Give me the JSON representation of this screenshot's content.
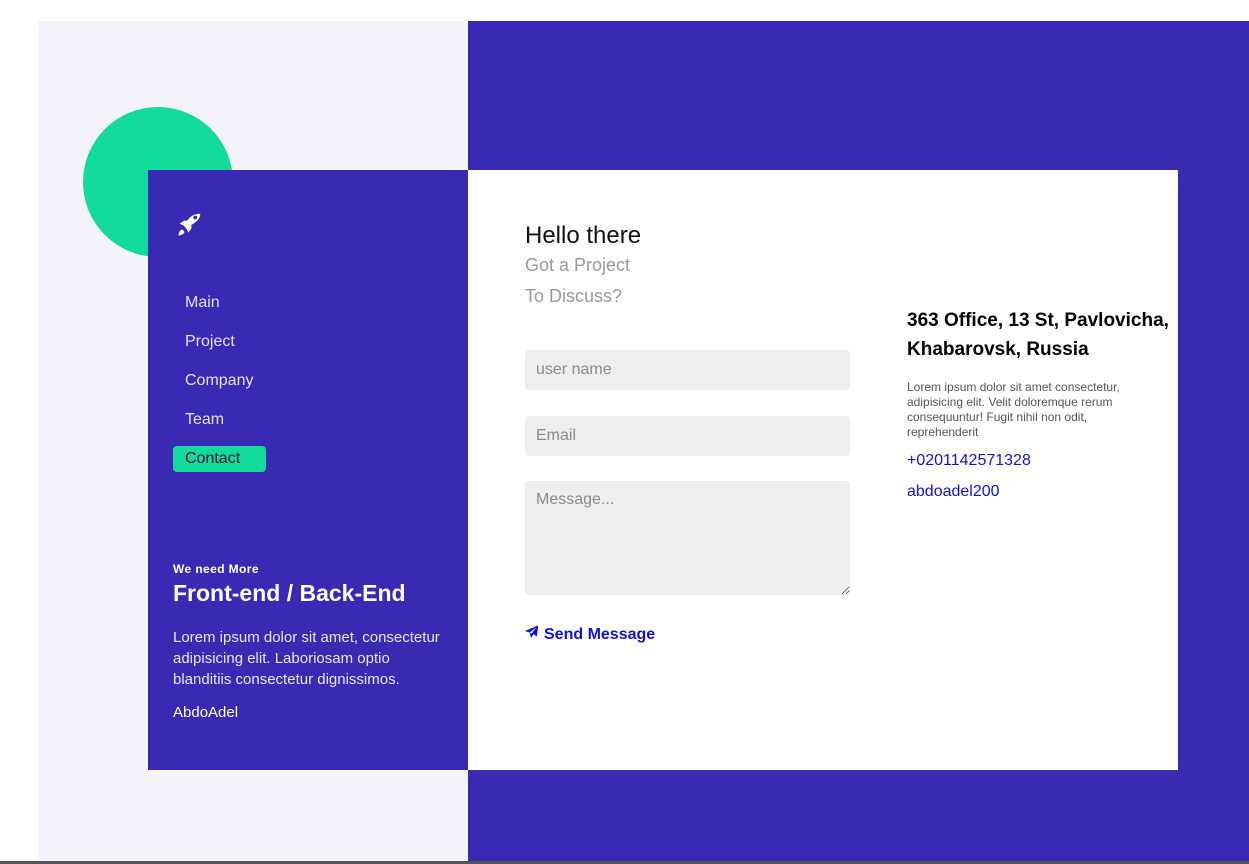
{
  "colors": {
    "accent": "#12db9b",
    "brand": "#3a29b3",
    "link": "#1212cc",
    "light_bg": "#f4f3f9"
  },
  "logo": {
    "icon": "rocket-icon"
  },
  "nav": {
    "items": [
      {
        "label": "Main"
      },
      {
        "label": "Project"
      },
      {
        "label": "Company"
      },
      {
        "label": "Team"
      },
      {
        "label": "Contact"
      }
    ],
    "active": "Contact"
  },
  "sidebar": {
    "eyebrow": "We need More",
    "headline": "Front-end / Back-End",
    "description": "Lorem ipsum dolor sit amet, consectetur adipisicing elit. Laboriosam optio blanditiis consectetur dignissimos.",
    "author": "AbdoAdel"
  },
  "form": {
    "title": "Hello there",
    "subtitle_line1": "Got a Project",
    "subtitle_line2": "To Discuss?",
    "name_placeholder": "user name",
    "email_placeholder": "Email",
    "message_placeholder": "Message...",
    "send_label": "Send Message",
    "send_icon": "paper-plane-icon"
  },
  "contact": {
    "address": "363 Office, 13 St, Pavlovicha, Khabarovsk, Russia",
    "description": "Lorem ipsum dolor sit amet consectetur, adipisicing elit. Velit doloremque rerum consequuntur! Fugit nihil non odit, reprehenderit",
    "phone": "+0201142571328",
    "email": "abdoadel200"
  }
}
